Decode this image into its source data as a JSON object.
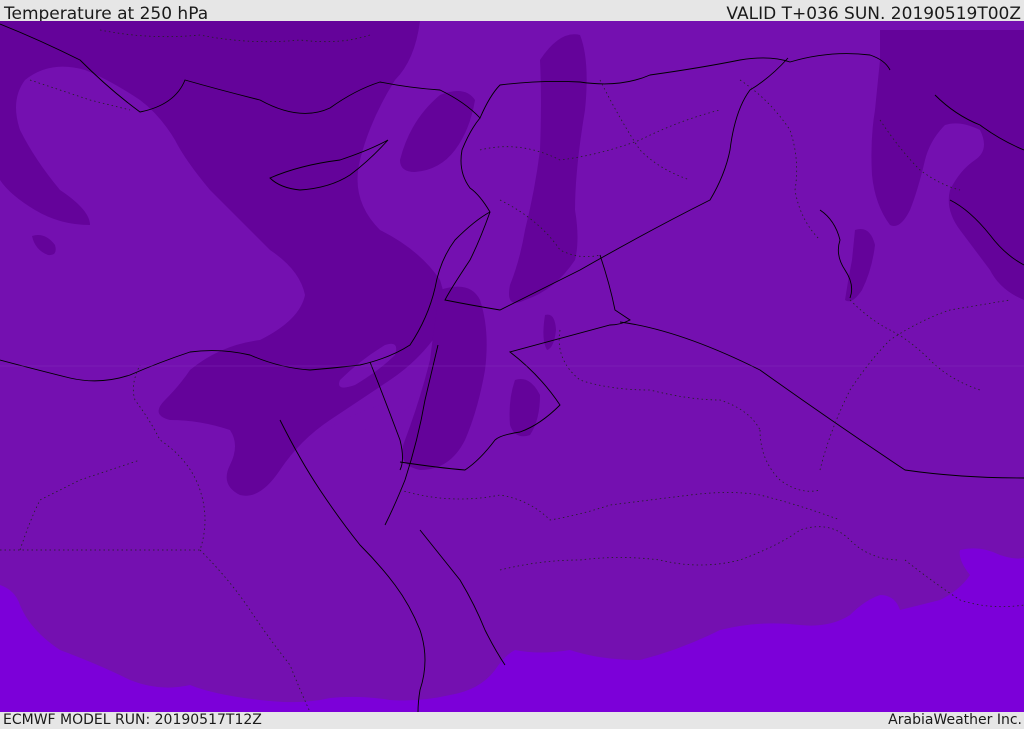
{
  "header": {
    "title": "Temperature at 250 hPa",
    "valid_time": "VALID T+036 SUN. 20190519T00Z"
  },
  "footer": {
    "model_run": "ECMWF MODEL RUN: 20190517T12Z",
    "credit": "ArabiaWeather Inc."
  },
  "colors": {
    "cold_dark": "#64039a",
    "mid_purple": "#7410b0",
    "warm_violet": "#7c00d9",
    "coastline": "#000000",
    "border_dotted": "#222222"
  }
}
